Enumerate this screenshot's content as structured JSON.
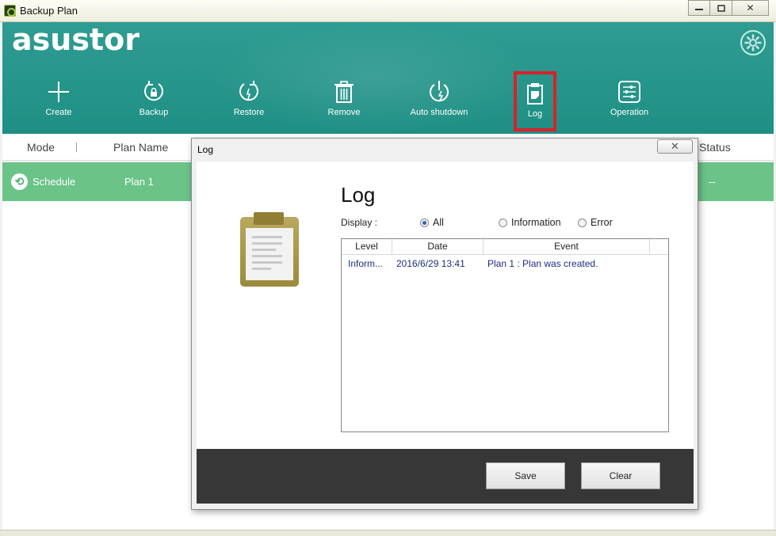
{
  "window": {
    "title": "Backup Plan",
    "minimize": "▭",
    "restore": "⧉",
    "close": "✕"
  },
  "header": {
    "logo": "asustor",
    "settings_icon": "gear-icon",
    "toolbar": [
      {
        "key": "create",
        "label": "Create",
        "icon": "plus-icon"
      },
      {
        "key": "backup",
        "label": "Backup",
        "icon": "backup-lock-icon"
      },
      {
        "key": "restore",
        "label": "Restore",
        "icon": "restore-arrow-icon"
      },
      {
        "key": "remove",
        "label": "Remove",
        "icon": "trash-icon"
      },
      {
        "key": "auto_shutdown",
        "label": "Auto shutdown",
        "icon": "power-icon"
      },
      {
        "key": "log",
        "label": "Log",
        "icon": "log-clipboard-icon",
        "active": true
      },
      {
        "key": "operation",
        "label": "Operation",
        "icon": "sliders-icon"
      }
    ]
  },
  "grid": {
    "columns": {
      "mode": "Mode",
      "plan_name": "Plan Name",
      "status": "Status"
    },
    "rows": [
      {
        "mode": "Schedule",
        "plan_name": "Plan 1",
        "status": "--"
      }
    ]
  },
  "dialog": {
    "title": "Log",
    "close": "✕",
    "heading": "Log",
    "display_label": "Display :",
    "filters": [
      {
        "label": "All",
        "selected": true
      },
      {
        "label": "Information",
        "selected": false
      },
      {
        "label": "Error",
        "selected": false
      }
    ],
    "columns": {
      "level": "Level",
      "date": "Date",
      "event": "Event"
    },
    "entries": [
      {
        "level": "Inform...",
        "date": "2016/6/29 13:41",
        "event": "Plan 1 : Plan was created."
      }
    ],
    "buttons": {
      "save": "Save",
      "clear": "Clear"
    }
  },
  "colors": {
    "header": "#23958a",
    "row_selected": "#6bc388",
    "active_outline": "#d9202a",
    "footer": "#373737"
  }
}
